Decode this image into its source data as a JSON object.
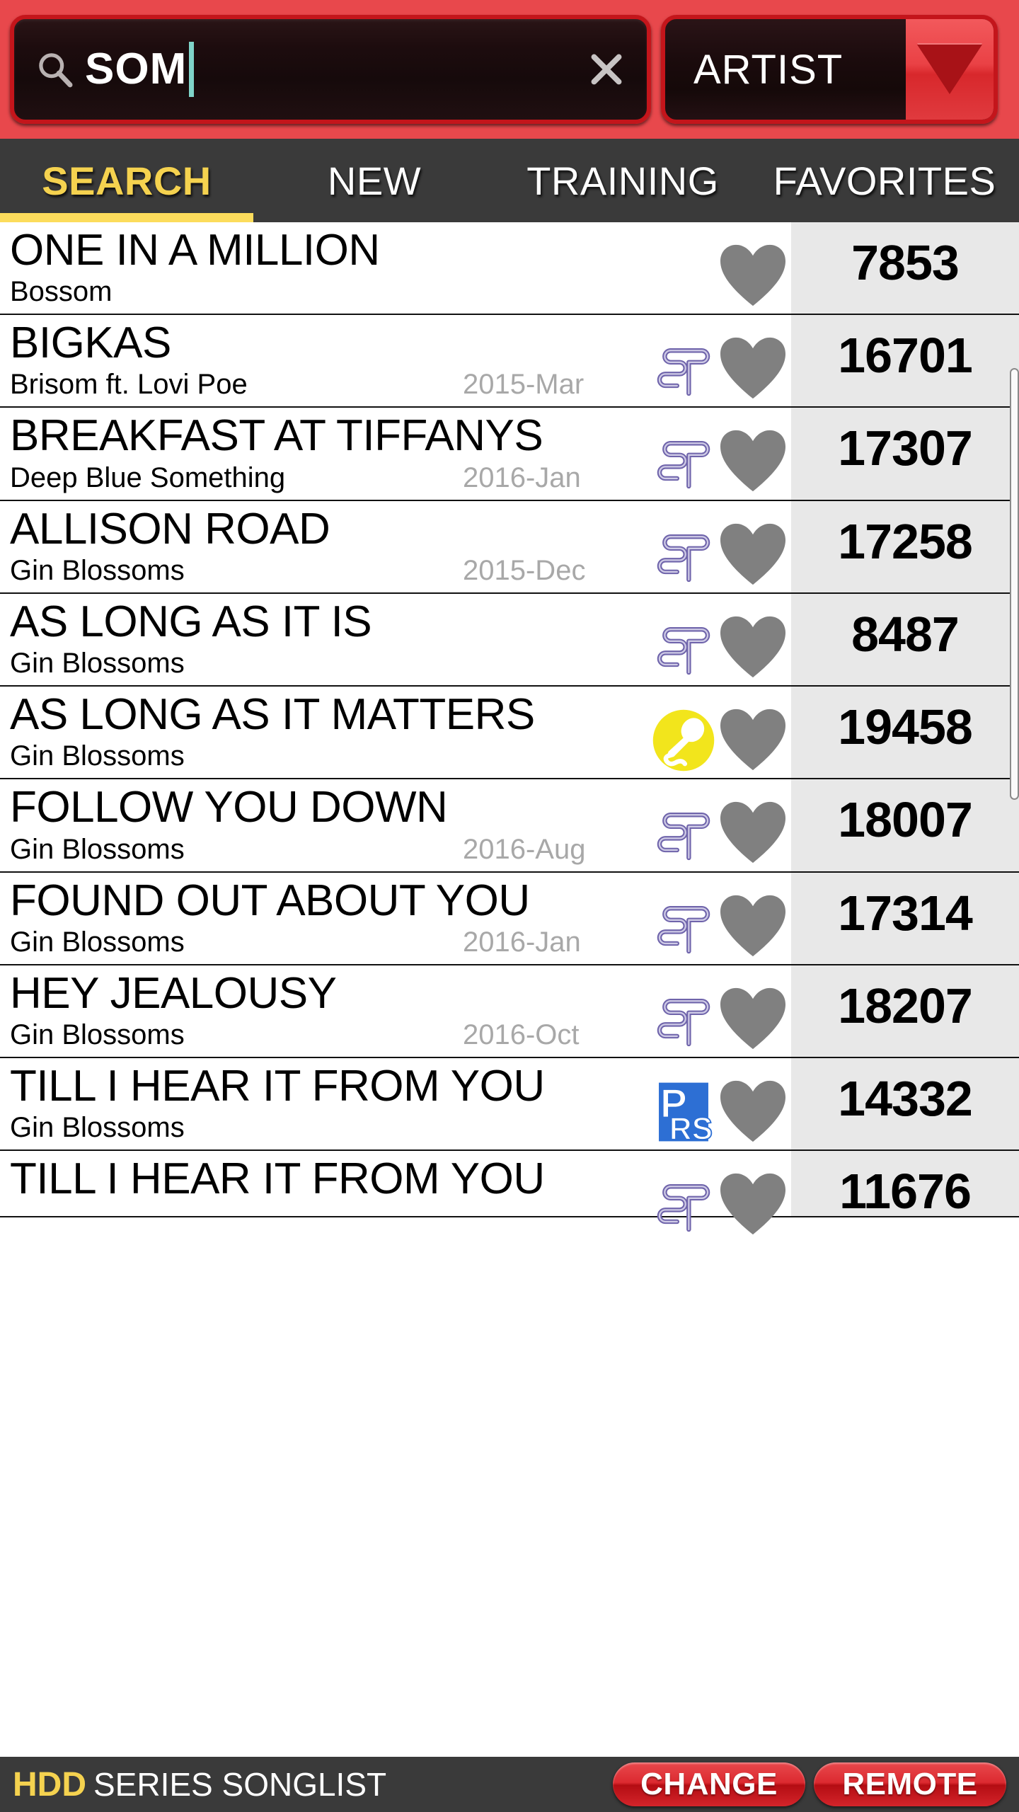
{
  "header": {
    "search": {
      "icon": "search-icon",
      "value": "SOM",
      "placeholder": "",
      "clear_icon": "close-icon"
    },
    "filter": {
      "label": "ARTIST",
      "arrow_icon": "chevron-down-icon"
    },
    "accent_red": "#e8484c",
    "border_red": "#c4151b"
  },
  "tabs": [
    {
      "label": "SEARCH",
      "active": true
    },
    {
      "label": "NEW",
      "active": false
    },
    {
      "label": "TRAINING",
      "active": false
    },
    {
      "label": "FAVORITES",
      "active": false
    }
  ],
  "tab_accent": "#fcdc5c",
  "songs": [
    {
      "title": "ONE IN A MILLION",
      "artist": "Bossom",
      "date": "",
      "tag": "none",
      "favorite_icon": "heart-icon",
      "score": "7853"
    },
    {
      "title": "BIGKAS",
      "artist": "Brisom ft. Lovi Poe",
      "date": "2015-Mar",
      "tag": "st",
      "favorite_icon": "heart-icon",
      "score": "16701"
    },
    {
      "title": "BREAKFAST AT TIFFANYS",
      "artist": "Deep Blue Something",
      "date": "2016-Jan",
      "tag": "st",
      "favorite_icon": "heart-icon",
      "score": "17307"
    },
    {
      "title": "ALLISON ROAD",
      "artist": "Gin Blossoms",
      "date": "2015-Dec",
      "tag": "st",
      "favorite_icon": "heart-icon",
      "score": "17258"
    },
    {
      "title": "AS LONG AS IT IS",
      "artist": "Gin Blossoms",
      "date": "",
      "tag": "st",
      "favorite_icon": "heart-icon",
      "score": "8487"
    },
    {
      "title": "AS LONG AS IT MATTERS",
      "artist": "Gin Blossoms",
      "date": "",
      "tag": "mic",
      "favorite_icon": "heart-icon",
      "score": "19458"
    },
    {
      "title": "FOLLOW YOU DOWN",
      "artist": "Gin Blossoms",
      "date": "2016-Aug",
      "tag": "st",
      "favorite_icon": "heart-icon",
      "score": "18007"
    },
    {
      "title": "FOUND OUT ABOUT YOU",
      "artist": "Gin Blossoms",
      "date": "2016-Jan",
      "tag": "st",
      "favorite_icon": "heart-icon",
      "score": "17314"
    },
    {
      "title": "HEY JEALOUSY",
      "artist": "Gin Blossoms",
      "date": "2016-Oct",
      "tag": "st",
      "favorite_icon": "heart-icon",
      "score": "18207"
    },
    {
      "title": "TILL I HEAR IT FROM YOU",
      "artist": "Gin Blossoms",
      "date": "",
      "tag": "prs",
      "favorite_icon": "heart-icon",
      "score": "14332"
    },
    {
      "title": "TILL I HEAR IT FROM YOU",
      "artist": "",
      "date": "",
      "tag": "st",
      "favorite_icon": "heart-icon",
      "score": "11676"
    }
  ],
  "tag_icon_names": {
    "st": "st-logo-icon",
    "mic": "microphone-icon",
    "prs": "prs-logo-icon",
    "none": "no-tag"
  },
  "colors": {
    "score_column": "#e8e8e8",
    "heart_gray": "#808080",
    "st_purple": "#6f64ab",
    "mic_yellow": "#f2e51c",
    "prs_blue": "#2d6fd4",
    "date_gray": "#a8a8a8"
  },
  "scrollbar": {
    "name": "vertical-scrollbar"
  },
  "footer": {
    "brand_prefix": "HDD",
    "brand_title": "SERIES SONGLIST",
    "buttons": [
      {
        "label": "CHANGE"
      },
      {
        "label": "REMOTE"
      }
    ]
  }
}
